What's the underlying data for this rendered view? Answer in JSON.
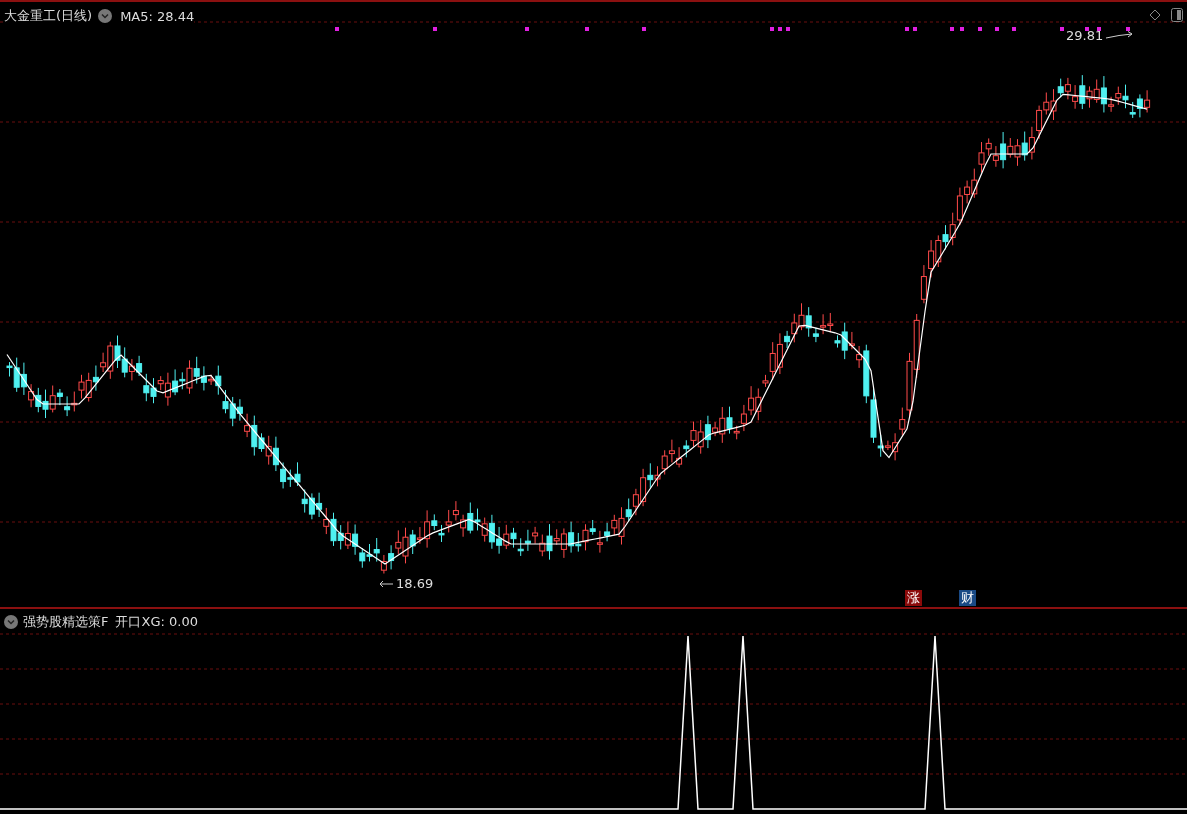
{
  "header": {
    "title": "大金重工(日线)",
    "indicator": "MA5: 28.44"
  },
  "price_labels": [
    {
      "kind": "low",
      "text": "18.69"
    },
    {
      "kind": "high",
      "text": "29.81"
    }
  ],
  "markers": [
    {
      "text": "涨",
      "color": "#8b0a0a"
    },
    {
      "text": "财",
      "color": "#1a4a85"
    }
  ],
  "sub_panel": {
    "title": "强势股精选策F",
    "indicator": "开口XG: 0.00"
  }
}
